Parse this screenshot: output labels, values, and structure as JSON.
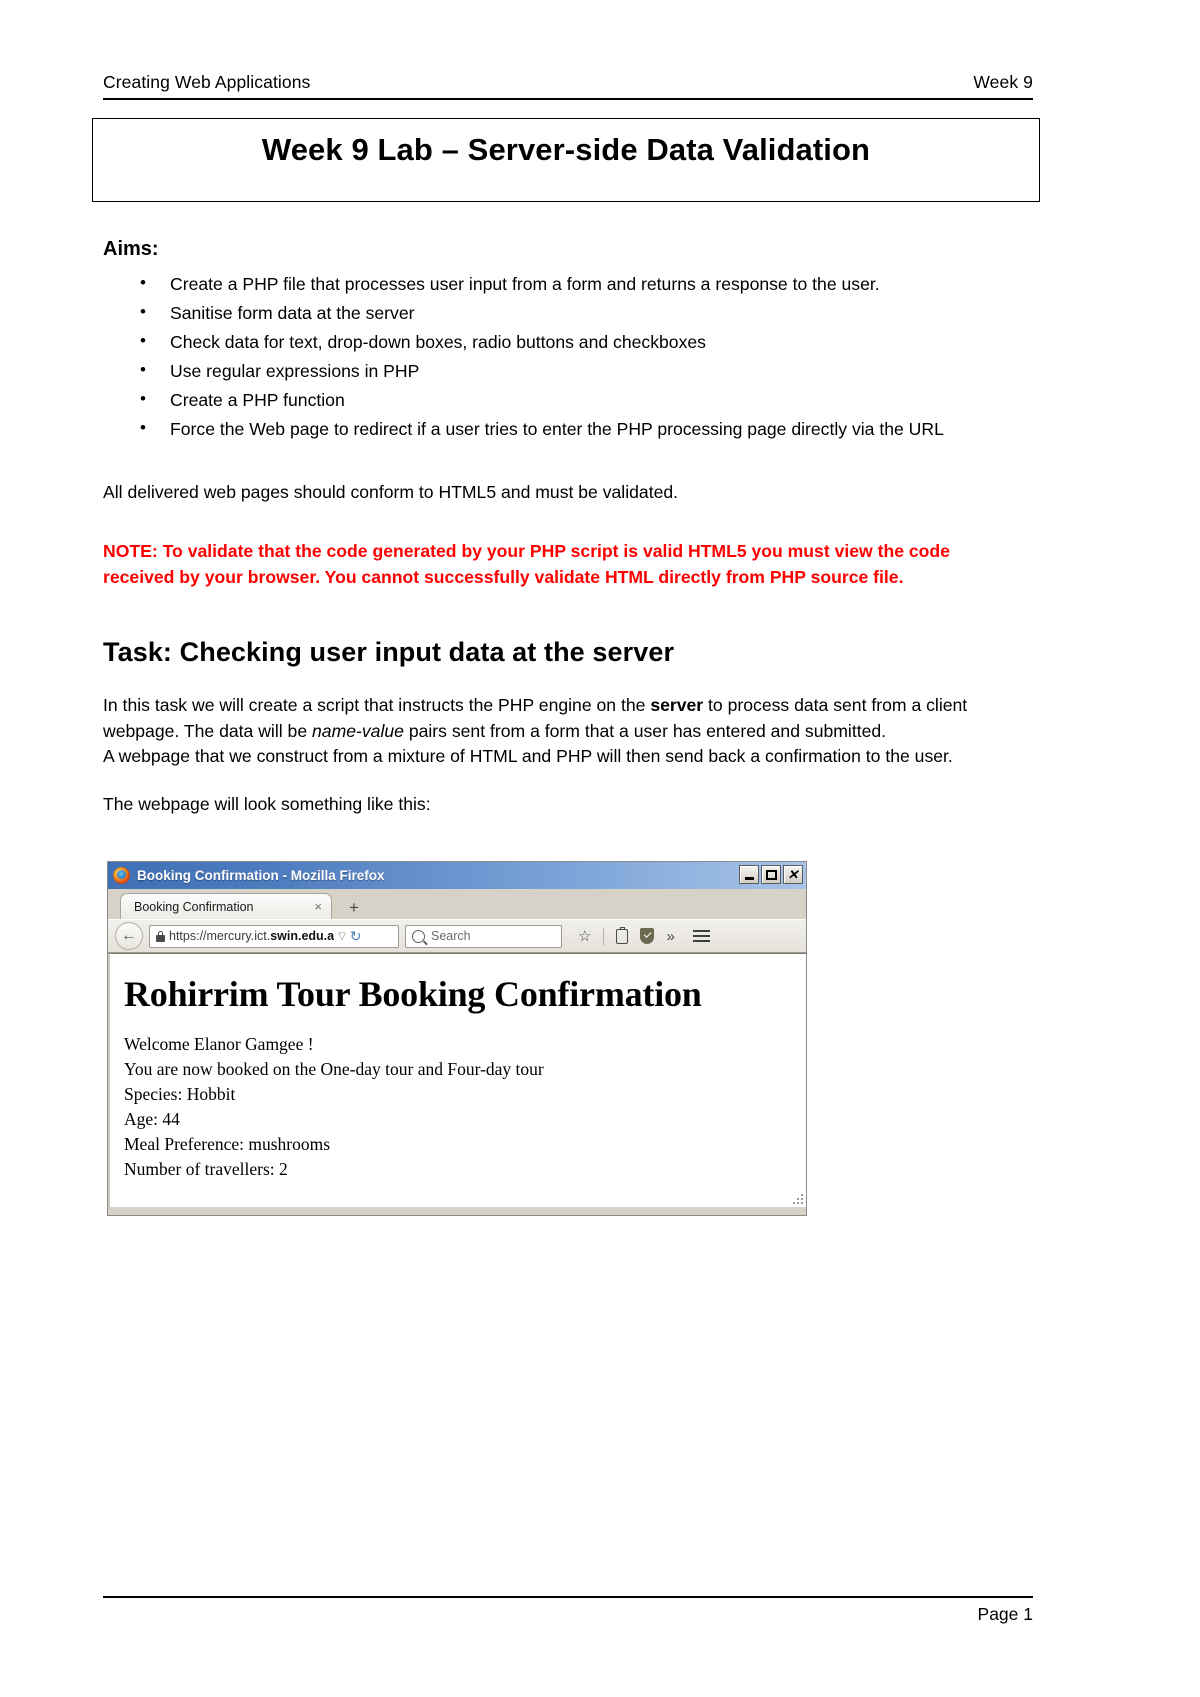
{
  "header": {
    "left": "Creating Web Applications",
    "right": "Week 9"
  },
  "title_box": {
    "title": "Week 9 Lab – Server-side Data Validation"
  },
  "aims": {
    "heading": "Aims:",
    "bullet_glyph": "•",
    "items": [
      "Create a PHP file that processes user input from a form and returns a response to the user.",
      "Sanitise form data at the server",
      "Check data for text, drop-down boxes, radio buttons and checkboxes",
      "Use regular expressions in PHP",
      "Create a PHP function",
      "Force the Web page to redirect if a user tries to enter the PHP processing page directly via the URL"
    ]
  },
  "body": {
    "conform_note": "All delivered web pages should conform to HTML5 and must be validated.",
    "note_red": "NOTE: To validate that the code generated by your PHP script is valid HTML5 you must view the code received by your browser. You cannot successfully validate HTML directly from PHP source file.",
    "task_heading": "Task: Checking user input data at the server",
    "para1_a": "In this task we will create a script that instructs the PHP engine on the ",
    "para1_strong": "server",
    "para1_b": " to process data sent from a client webpage. The data will be ",
    "para1_ital": "name-value",
    "para1_c": " pairs sent from a form that a user has entered and submitted.",
    "para2": "A webpage that we construct from a mixture of HTML and PHP will then send back a confirmation to the user.",
    "para3": "The webpage will look something like this:"
  },
  "browser": {
    "window_title": "Booking Confirmation - Mozilla Firefox",
    "minimize_label": "–",
    "maximize_label": "□",
    "close_label": "✕",
    "tab_label": "Booking Confirmation",
    "tab_close_glyph": "×",
    "new_tab_glyph": "+",
    "back_glyph": "←",
    "url_prefix": "https://mercury.ict.",
    "url_domain": "swin.edu.",
    "url_suffix": "a",
    "url_caret_glyph": "▽",
    "reload_glyph": "↻",
    "search_placeholder": "Search",
    "bookmark_star_glyph": "☆",
    "overflow_glyph": "»",
    "page": {
      "h1": "Rohirrim Tour Booking Confirmation",
      "lines": [
        "Welcome Elanor Gamgee !",
        "You are now booked on the One-day tour and Four-day tour",
        "Species: Hobbit",
        "Age: 44",
        "Meal Preference: mushrooms",
        "Number of travellers: 2"
      ]
    }
  },
  "footer": {
    "page_label": "Page 1"
  },
  "colors": {
    "note_red": "#FF0000",
    "titlebar_blue": "#4f7dc0",
    "chrome_grey": "#d6d2c8"
  }
}
